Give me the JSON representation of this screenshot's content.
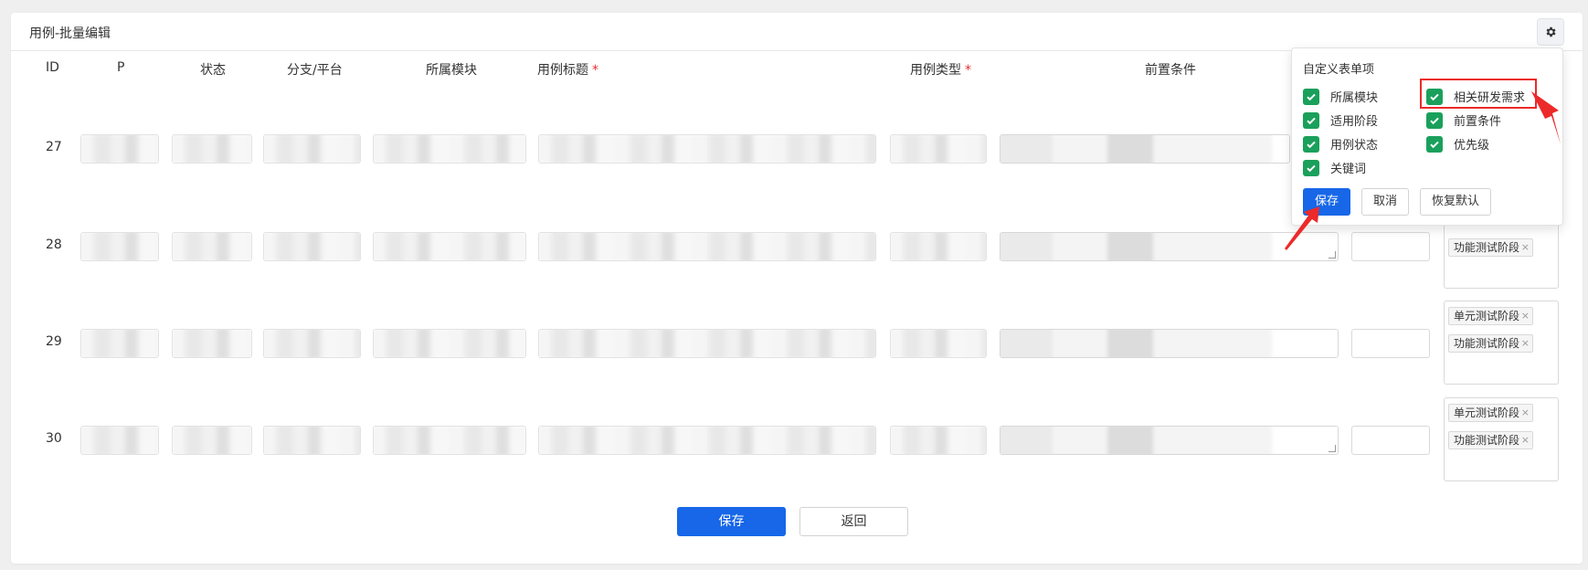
{
  "page": {
    "title": "用例-批量编辑"
  },
  "table": {
    "headers": {
      "id": "ID",
      "p": "P",
      "status": "状态",
      "branch": "分支/平台",
      "module": "所属模块",
      "case_title": "用例标题",
      "case_type": "用例类型",
      "precondition": "前置条件",
      "required_mark": "*"
    },
    "rows": [
      {
        "id": "27",
        "tags": []
      },
      {
        "id": "28",
        "tags": [
          "功能测试阶段"
        ]
      },
      {
        "id": "29",
        "tags": [
          "单元测试阶段",
          "功能测试阶段"
        ]
      },
      {
        "id": "30",
        "tags": [
          "单元测试阶段",
          "功能测试阶段"
        ]
      }
    ]
  },
  "tag_remove_symbol": "×",
  "footer": {
    "save_label": "保存",
    "back_label": "返回"
  },
  "popover": {
    "title": "自定义表单项",
    "options": [
      {
        "label": "所属模块",
        "checked": true
      },
      {
        "label": "相关研发需求",
        "checked": true
      },
      {
        "label": "适用阶段",
        "checked": true
      },
      {
        "label": "前置条件",
        "checked": true
      },
      {
        "label": "用例状态",
        "checked": true
      },
      {
        "label": "优先级",
        "checked": true
      },
      {
        "label": "关键词",
        "checked": true
      }
    ],
    "save_label": "保存",
    "cancel_label": "取消",
    "reset_label": "恢复默认"
  },
  "colors": {
    "primary": "#1767e8",
    "checkbox": "#1aa05b",
    "required": "#ee2b2b",
    "annotation": "#ec2a2a"
  }
}
